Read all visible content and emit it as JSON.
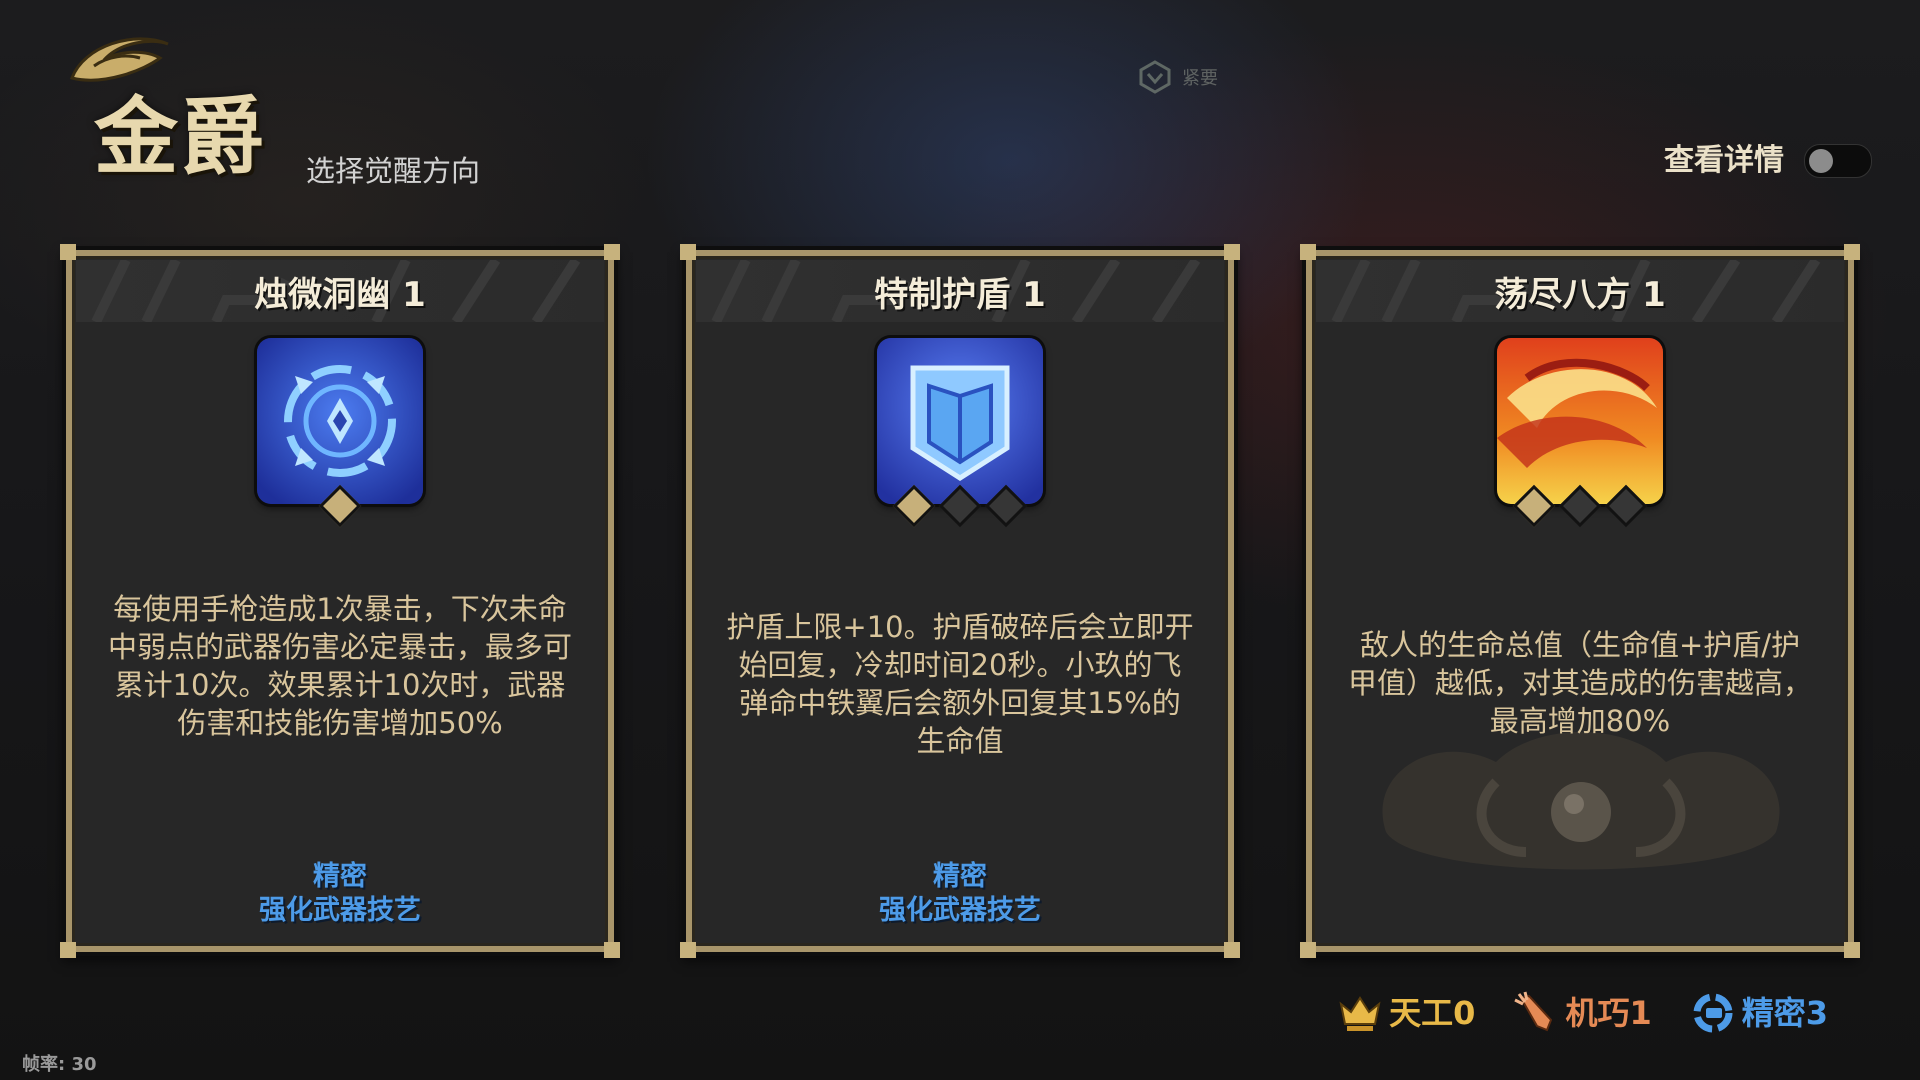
{
  "header": {
    "title": "金爵",
    "subtitle": "选择觉醒方向",
    "details_label": "查看详情",
    "details_toggle_on": false,
    "bg_emblem_text": "紧要"
  },
  "cards": [
    {
      "title": "烛微洞幽 1",
      "level": 1,
      "max_level": 1,
      "description": "每使用手枪造成1次暴击，下次未命中弱点的武器伤害必定暴击，最多可累计10次。效果累计10次时，武器伤害和技能伤害增加50%",
      "tag_type": "精密",
      "tag_effect": "强化武器技艺",
      "icon": "crosshair-icon",
      "icon_color": "#2f53c8"
    },
    {
      "title": "特制护盾 1",
      "level": 1,
      "max_level": 3,
      "description": "护盾上限+10。护盾破碎后会立即开始回复，冷却时间20秒。小玖的飞弹命中铁翼后会额外回复其15%的生命值",
      "tag_type": "精密",
      "tag_effect": "强化武器技艺",
      "icon": "shield-icon",
      "icon_color": "#3a5bd6"
    },
    {
      "title": "荡尽八方 1",
      "level": 1,
      "max_level": 3,
      "description": "敌人的生命总值（生命值+护盾/护甲值）越低，对其造成的伤害越高，最高增加80%",
      "tag_type": "",
      "tag_effect": "",
      "icon": "flame-swirl-icon",
      "icon_color": "#e2531f"
    }
  ],
  "resources": [
    {
      "name": "天工",
      "value": 0,
      "icon": "crown-icon",
      "color": "#e8b948"
    },
    {
      "name": "机巧",
      "value": 1,
      "icon": "gear-carrot-icon",
      "color": "#e58a55"
    },
    {
      "name": "精密",
      "value": 3,
      "icon": "precision-icon",
      "color": "#4d9be8"
    }
  ],
  "fps_label": "帧率: 30",
  "colors": {
    "card_border": "#a8956a",
    "desc_text": "#d9c59c",
    "tag_blue": "#4d9be8",
    "title_gold": "#e7d8ae"
  }
}
